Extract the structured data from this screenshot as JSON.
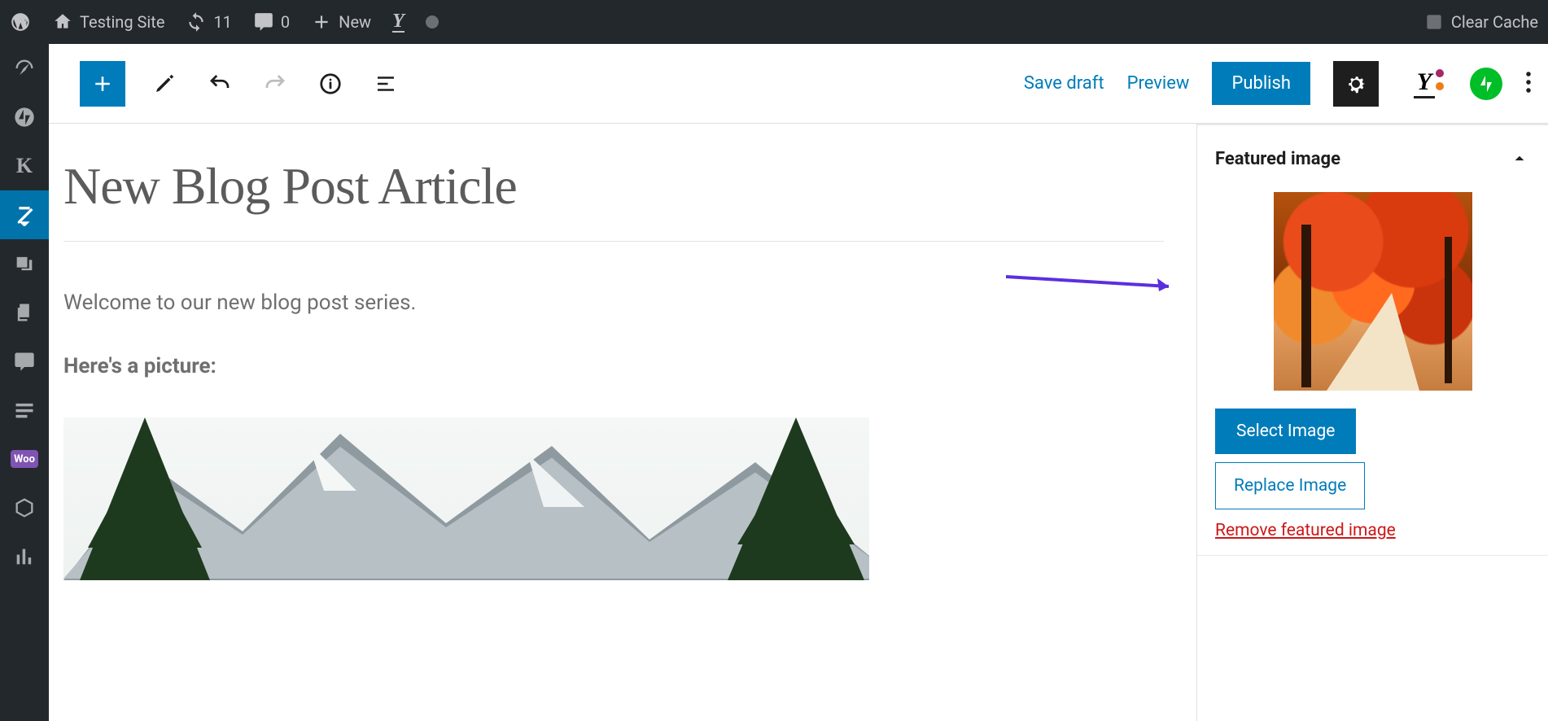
{
  "adminBar": {
    "siteName": "Testing Site",
    "updatesCount": "11",
    "commentsCount": "0",
    "newLabel": "New",
    "clearCache": "Clear Cache"
  },
  "toolbar": {
    "saveDraft": "Save draft",
    "preview": "Preview",
    "publish": "Publish"
  },
  "post": {
    "title": "New Blog Post Article",
    "intro": "Welcome to our new blog post series.",
    "pictureLabel": "Here's a picture:"
  },
  "sidebar": {
    "panelTitle": "Featured image",
    "selectImage": "Select Image",
    "replaceImage": "Replace Image",
    "removeImage": "Remove featured image"
  }
}
